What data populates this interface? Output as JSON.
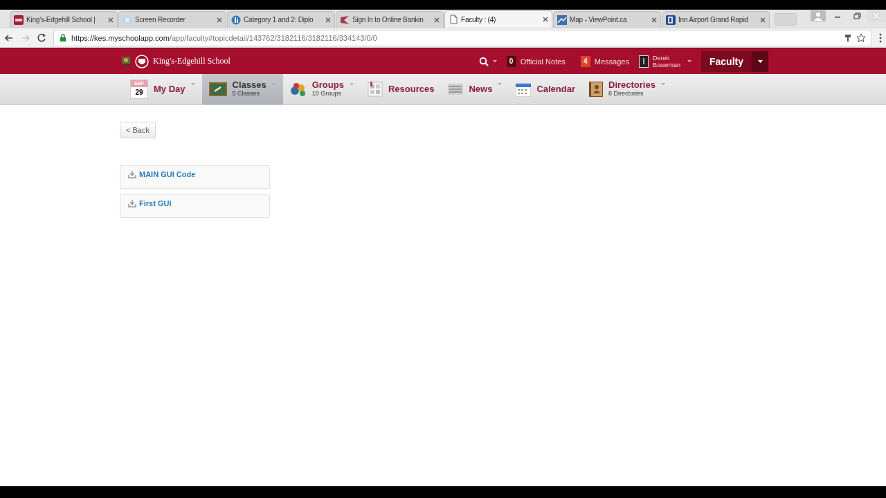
{
  "browser": {
    "tabs": [
      {
        "title": "King's-Edgehill School |",
        "selected": false
      },
      {
        "title": "Screen Recorder",
        "selected": false
      },
      {
        "title": "Category 1 and 2: Diplo",
        "selected": false
      },
      {
        "title": "Sign In to Online Bankin",
        "selected": false
      },
      {
        "title": "Faculty : (4)",
        "selected": true
      },
      {
        "title": "Map - ViewPoint.ca",
        "selected": false
      },
      {
        "title": "Inn Airport Grand Rapid",
        "selected": false
      }
    ],
    "address": {
      "host": "https://kes.myschoolapp.com",
      "path": "/app/faculty#topicdetail/143762/3182116/3182116/334143/0/0"
    }
  },
  "header": {
    "school_name": "King's-Edgehill School",
    "notices": [
      {
        "count": "0",
        "label": "Official Notes",
        "color": "#5a0a14"
      },
      {
        "count": "4",
        "label": "Messages",
        "color": "#e0412a"
      }
    ],
    "user": "Derek Bouwman",
    "role": "Faculty"
  },
  "nav": [
    {
      "kind": "date",
      "month": "SEP",
      "day": "29",
      "label": "My Day",
      "caret": true,
      "selected": false
    },
    {
      "kind": "menu",
      "label": "Classes",
      "sub": "5 Classes",
      "caret": true,
      "selected": true
    },
    {
      "kind": "menu",
      "label": "Groups",
      "sub": "10 Groups",
      "caret": true,
      "selected": false
    },
    {
      "kind": "menu",
      "label": "Resources",
      "caret": false,
      "selected": false
    },
    {
      "kind": "menu",
      "label": "News",
      "caret": true,
      "selected": false
    },
    {
      "kind": "menu",
      "label": "Calendar",
      "caret": false,
      "selected": false
    },
    {
      "kind": "menu",
      "label": "Directories",
      "sub": "8 Directories",
      "caret": true,
      "selected": false
    }
  ],
  "content": {
    "back": "< Back",
    "files": [
      "MAIN GUI Code",
      "First GUI"
    ]
  }
}
